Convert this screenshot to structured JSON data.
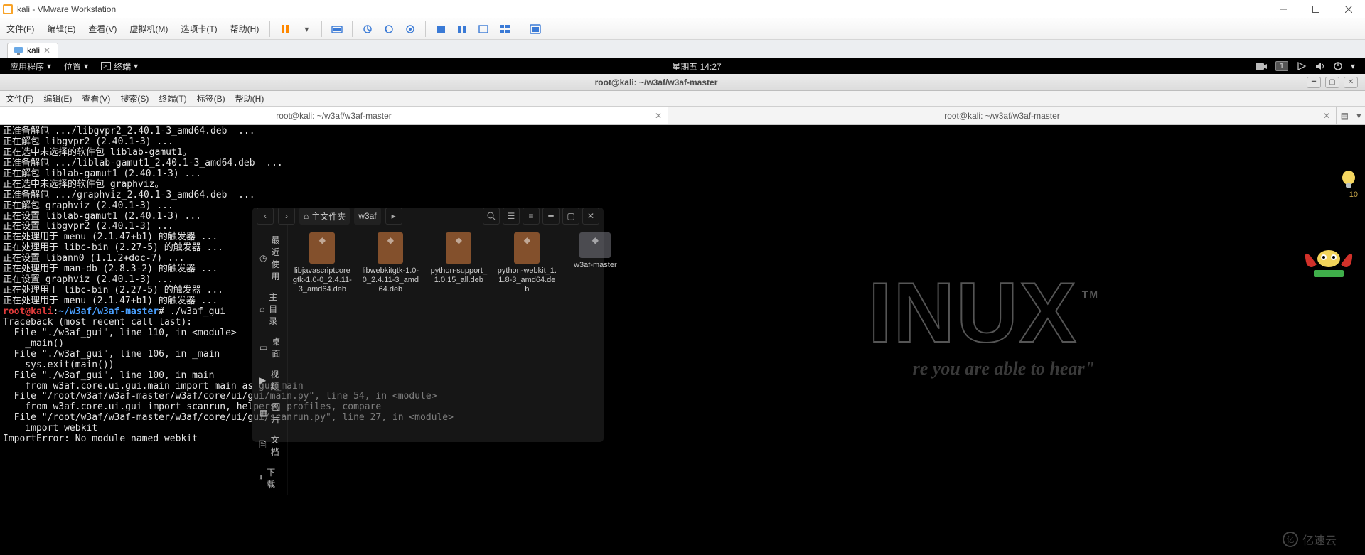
{
  "window": {
    "title": "kali - VMware Workstation"
  },
  "vmware_menu": {
    "file": "文件(F)",
    "edit": "编辑(E)",
    "view": "查看(V)",
    "vm": "虚拟机(M)",
    "tabs": "选项卡(T)",
    "help": "帮助(H)"
  },
  "vm_tab": {
    "label": "kali"
  },
  "kali_panel": {
    "apps": "应用程序",
    "places": "位置",
    "terminal_label": "终端",
    "clock": "星期五 14:27",
    "workspace_badge": "1"
  },
  "term_window": {
    "title": "root@kali: ~/w3af/w3af-master"
  },
  "term_menu": {
    "file": "文件(F)",
    "edit": "编辑(E)",
    "view": "查看(V)",
    "search": "搜索(S)",
    "terminal": "终端(T)",
    "tabs": "标签(B)",
    "help": "帮助(H)"
  },
  "term_tabs": {
    "tab1": "root@kali: ~/w3af/w3af-master",
    "tab2": "root@kali: ~/w3af/w3af-master"
  },
  "terminal": {
    "lines_a": "正准备解包 .../libgvpr2_2.40.1-3_amd64.deb  ...\n正在解包 libgvpr2 (2.40.1-3) ...\n正在选中未选择的软件包 liblab-gamut1。\n正准备解包 .../liblab-gamut1_2.40.1-3_amd64.deb  ...\n正在解包 liblab-gamut1 (2.40.1-3) ...\n正在选中未选择的软件包 graphviz。\n正准备解包 .../graphviz_2.40.1-3_amd64.deb  ...\n正在解包 graphviz (2.40.1-3) ...\n正在设置 liblab-gamut1 (2.40.1-3) ...\n正在设置 libgvpr2 (2.40.1-3) ...\n正在处理用于 menu (2.1.47+b1) 的触发器 ...\n正在处理用于 libc-bin (2.27-5) 的触发器 ...\n正在设置 libann0 (1.1.2+doc-7) ...\n正在处理用于 man-db (2.8.3-2) 的触发器 ...\n正在设置 graphviz (2.40.1-3) ...\n正在处理用于 libc-bin (2.27-5) 的触发器 ...\n正在处理用于 menu (2.1.47+b1) 的触发器 ...",
    "prompt_user": "root@kali",
    "prompt_sep": ":",
    "prompt_path": "~/w3af/w3af-master",
    "prompt_hash": "#",
    "prompt_cmd": " ./w3af_gui",
    "lines_b": "Traceback (most recent call last):\n  File \"./w3af_gui\", line 110, in <module>\n    _main()\n  File \"./w3af_gui\", line 106, in _main\n    sys.exit(main())\n  File \"./w3af_gui\", line 100, in main\n    from w3af.core.ui.gui.main import main as gui_main\n  File \"/root/w3af/w3af-master/w3af/core/ui/gui/main.py\", line 54, in <module>\n    from w3af.core.ui.gui import scanrun, helpers, profiles, compare\n  File \"/root/w3af/w3af-master/w3af/core/ui/gui/scanrun.py\", line 27, in <module>\n    import webkit\nImportError: No module named webkit"
  },
  "files": {
    "crumb_home": "主文件夹",
    "crumb_w3af": "w3af",
    "side": {
      "recent": "最近使用",
      "home": "主目录",
      "desktop": "桌面",
      "videos": "视频",
      "pictures": "图片",
      "documents": "文档",
      "downloads": "下载"
    },
    "items": [
      {
        "name": "libjavascriptcoregtk-1.0-0_2.4.11-3_amd64.deb"
      },
      {
        "name": "libwebkitgtk-1.0-0_2.4.11-3_amd64.deb"
      },
      {
        "name": "python-support_1.0.15_all.deb"
      },
      {
        "name": "python-webkit_1.1.8-3_amd64.deb"
      },
      {
        "name": "w3af-master"
      }
    ]
  },
  "bg": {
    "word": "INUX",
    "slogan": "re you are able to hear\"",
    "tm": "TM"
  },
  "badge": {
    "num": "10"
  },
  "watermark": {
    "text": "亿速云"
  }
}
